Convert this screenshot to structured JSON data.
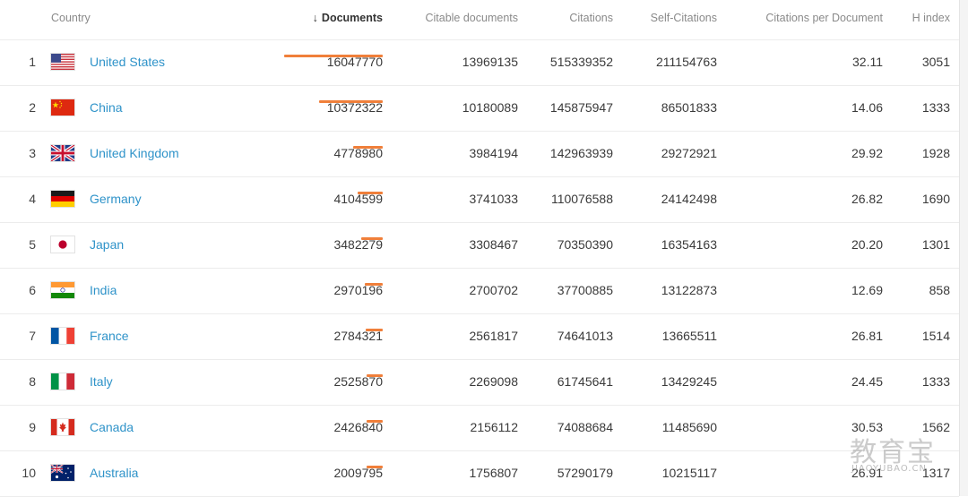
{
  "header": {
    "country": "Country",
    "documents": "Documents",
    "sort_arrow": "↓",
    "citable_documents": "Citable documents",
    "citations": "Citations",
    "self_citations": "Self-Citations",
    "citations_per_document": "Citations per Document",
    "h_index": "H index"
  },
  "accent_color": "#f07f3a",
  "link_color": "#2f93c9",
  "rows": [
    {
      "rank": "1",
      "flag": "us-flag",
      "country": "United States",
      "documents": "16047770",
      "citable": "13969135",
      "citations": "515339352",
      "self": "211154763",
      "cpd": "32.11",
      "h": "3051",
      "doc_share": 1.0
    },
    {
      "rank": "2",
      "flag": "china-flag",
      "country": "China",
      "documents": "10372322",
      "citable": "10180089",
      "citations": "145875947",
      "self": "86501833",
      "cpd": "14.06",
      "h": "1333",
      "doc_share": 0.646
    },
    {
      "rank": "3",
      "flag": "uk-flag",
      "country": "United Kingdom",
      "documents": "4778980",
      "citable": "3984194",
      "citations": "142963939",
      "self": "29272921",
      "cpd": "29.92",
      "h": "1928",
      "doc_share": 0.298
    },
    {
      "rank": "4",
      "flag": "germany-flag",
      "country": "Germany",
      "documents": "4104599",
      "citable": "3741033",
      "citations": "110076588",
      "self": "24142498",
      "cpd": "26.82",
      "h": "1690",
      "doc_share": 0.256
    },
    {
      "rank": "5",
      "flag": "japan-flag",
      "country": "Japan",
      "documents": "3482279",
      "citable": "3308467",
      "citations": "70350390",
      "self": "16354163",
      "cpd": "20.20",
      "h": "1301",
      "doc_share": 0.217
    },
    {
      "rank": "6",
      "flag": "india-flag",
      "country": "India",
      "documents": "2970196",
      "citable": "2700702",
      "citations": "37700885",
      "self": "13122873",
      "cpd": "12.69",
      "h": "858",
      "doc_share": 0.185
    },
    {
      "rank": "7",
      "flag": "france-flag",
      "country": "France",
      "documents": "2784321",
      "citable": "2561817",
      "citations": "74641013",
      "self": "13665511",
      "cpd": "26.81",
      "h": "1514",
      "doc_share": 0.174
    },
    {
      "rank": "8",
      "flag": "italy-flag",
      "country": "Italy",
      "documents": "2525870",
      "citable": "2269098",
      "citations": "61745641",
      "self": "13429245",
      "cpd": "24.45",
      "h": "1333",
      "doc_share": 0.157
    },
    {
      "rank": "9",
      "flag": "canada-flag",
      "country": "Canada",
      "documents": "2426840",
      "citable": "2156112",
      "citations": "74088684",
      "self": "11485690",
      "cpd": "30.53",
      "h": "1562",
      "doc_share": 0.151
    },
    {
      "rank": "10",
      "flag": "australia-flag",
      "country": "Australia",
      "documents": "2009795",
      "citable": "1756807",
      "citations": "57290179",
      "self": "10215117",
      "cpd": "26.91",
      "h": "1317",
      "doc_share": 0.125
    }
  ],
  "watermark": {
    "main": "教育宝",
    "sub": "JIAOYUBAO.CN"
  }
}
